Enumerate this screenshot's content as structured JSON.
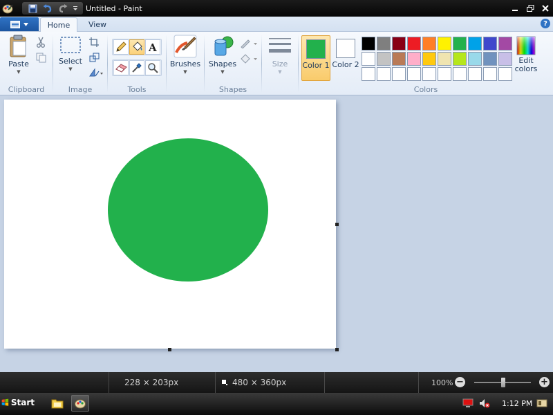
{
  "window": {
    "title": "Untitled - Paint"
  },
  "tabs": {
    "home": "Home",
    "view": "View"
  },
  "ribbon": {
    "clipboard": {
      "group_label": "Clipboard",
      "paste_label": "Paste"
    },
    "image": {
      "group_label": "Image",
      "select_label": "Select"
    },
    "tools": {
      "group_label": "Tools"
    },
    "brushes": {
      "label": "Brushes"
    },
    "shapes": {
      "group_label": "Shapes",
      "shapes_label": "Shapes"
    },
    "size": {
      "label": "Size"
    },
    "colors": {
      "group_label": "Colors",
      "color1_label": "Color 1",
      "color1_num": "",
      "color2_label": "Color 2",
      "color1_value": "#22b14c",
      "color2_value": "#ffffff",
      "edit_label": "Edit colors",
      "palette": [
        "#000000",
        "#7f7f7f",
        "#880015",
        "#ed1c24",
        "#ff7f27",
        "#fff200",
        "#22b14c",
        "#00a2e8",
        "#3f48cc",
        "#a349a4",
        "#ffffff",
        "#c3c3c3",
        "#b97a57",
        "#ffaec9",
        "#ffc90e",
        "#efe4b0",
        "#b5e61d",
        "#99d9ea",
        "#7092be",
        "#c8bfe7",
        "#ffffff",
        "#ffffff",
        "#ffffff",
        "#ffffff",
        "#ffffff",
        "#ffffff",
        "#ffffff",
        "#ffffff",
        "#ffffff",
        "#ffffff"
      ]
    }
  },
  "canvas": {
    "shape_color": "#22b14c"
  },
  "status": {
    "cursor_pos": "228 × 203px",
    "canvas_size": "480 × 360px",
    "zoom": "100%",
    "zoom_minus": "−",
    "zoom_plus": "+"
  },
  "taskbar": {
    "start_label": "Start",
    "clock": "1:12 PM"
  }
}
